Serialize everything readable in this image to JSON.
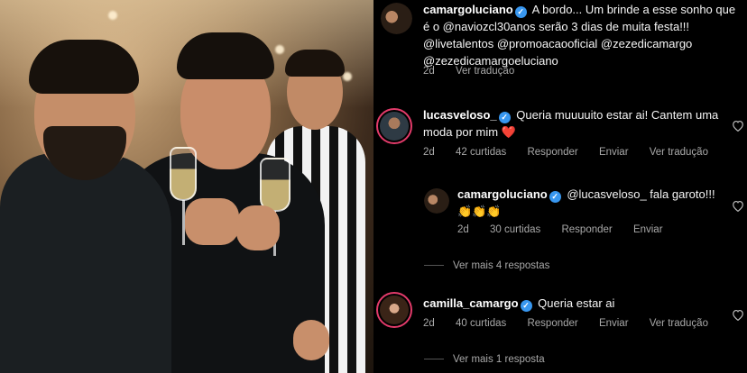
{
  "post_caption": {
    "username": "camargoluciano",
    "text": "A bordo... Um brinde a esse sonho que é o @naviozcl30anos serão 3 dias de muita festa!!! @livetalentos @promoacaooficial @zezedicamargo @zezedicamargoeluciano",
    "time": "2d",
    "see_translation": "Ver tradução"
  },
  "comments": [
    {
      "username": "lucasveloso_",
      "text": "Queria muuuuito estar ai! Cantem uma moda por mim",
      "emoji": "❤️",
      "time": "2d",
      "likes": "42 curtidas",
      "reply": "Responder",
      "send": "Enviar",
      "see_translation": "Ver tradução",
      "reply_item": {
        "username": "camargoluciano",
        "text": "@lucasveloso_ fala garoto!!!",
        "emoji": "👏👏👏",
        "time": "2d",
        "likes": "30 curtidas",
        "reply": "Responder",
        "send": "Enviar"
      },
      "more_replies": "Ver mais 4 respostas"
    },
    {
      "username": "camilla_camargo",
      "text": "Queria estar ai",
      "time": "2d",
      "likes": "40 curtidas",
      "reply": "Responder",
      "send": "Enviar",
      "see_translation": "Ver tradução",
      "more_replies": "Ver mais 1 resposta"
    }
  ],
  "colors": {
    "background": "#000000",
    "verified": "#3897f0",
    "muted_text": "#a8a8a8",
    "story_ring": "#e23b6a"
  },
  "icons": {
    "verified": "verified-badge-icon",
    "like": "heart-outline-icon"
  }
}
